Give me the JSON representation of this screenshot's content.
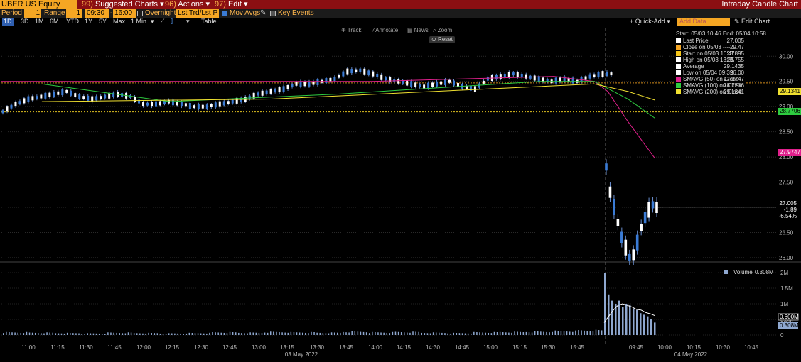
{
  "topbar": {
    "security": "UBER US Equity",
    "menus": [
      {
        "num": "99)",
        "label": "Suggested Charts",
        "arrow": "▾"
      },
      {
        "num": "96)",
        "label": "Actions",
        "arrow": "▾"
      },
      {
        "num": "97)",
        "label": "Edit",
        "arrow": "▾"
      }
    ],
    "title": "Intraday Candle Chart"
  },
  "settings": {
    "period_label": "Period",
    "period_value": "1",
    "range_label": "Range",
    "range_value": "1",
    "start_time": "09:30",
    "dash": "-",
    "end_time": "16:00",
    "overnight_label": "Overnight",
    "last_trd_value": "Lst Trd/Lst P",
    "mov_avgs_label": "Mov Avgs",
    "key_events_label": "Key Events"
  },
  "range_tabs": [
    "1D",
    "3D",
    "1M",
    "6M",
    "YTD",
    "1Y",
    "5Y",
    "Max"
  ],
  "interval": "1 Min",
  "interval_arrow": "▾",
  "table_label": "Table",
  "quick_add": "Quick-Add",
  "add_data_placeholder": "Add Data",
  "edit_chart": "Edit Chart",
  "chart_tools": {
    "track": "Track",
    "annotate": "Annotate",
    "news": "News",
    "zoom": "Zoom",
    "reset": "Reset"
  },
  "legend": {
    "header": "Start: 05/03 10:46 End: 05/04 10:58",
    "rows": [
      {
        "label": "Last Price",
        "value": "27.005",
        "color": "#ffffff"
      },
      {
        "label": "Close on 05/03 ----",
        "value": "29.47",
        "color": "#f5a623"
      },
      {
        "label": "Start on 05/03 10:47",
        "value": "28.895",
        "color": "#f5c518"
      },
      {
        "label": "High on 05/03 13:55",
        "value": "29.755",
        "color": "#ffffff"
      },
      {
        "label": "Average",
        "value": "29.1435",
        "color": "#ffffff"
      },
      {
        "label": "Low on 05/04 09:39",
        "value": "26.00",
        "color": "#ffffff"
      },
      {
        "label": "SMAVG (50)  on Close",
        "value": "27.9747",
        "color": "#e0208c"
      },
      {
        "label": "SMAVG (100)  on Close",
        "value": "28.7706",
        "color": "#2ecc40"
      },
      {
        "label": "SMAVG (200)  on Close",
        "value": "29.1341",
        "color": "#f0e030"
      }
    ]
  },
  "price_tags": [
    {
      "text": "29.1341",
      "bg": "#f0e030",
      "fg": "#000"
    },
    {
      "text": "28.7706",
      "bg": "#2ecc40",
      "fg": "#000"
    },
    {
      "text": "27.9747",
      "bg": "#e0208c",
      "fg": "#fff"
    }
  ],
  "last_tag": {
    "line1": "27.005",
    "line2": "-1.89",
    "line3": "-6.54%"
  },
  "volume_legend": {
    "label": "Volume",
    "value": "0.308M"
  },
  "volume_tags": {
    "avg": "0.600M",
    "last": "0.308M"
  },
  "chart_data": {
    "type": "candlestick",
    "y_ticks": [
      "30.00",
      "29.50",
      "29.00",
      "28.50",
      "28.00",
      "27.50",
      "27.00",
      "26.50",
      "26.00"
    ],
    "ylim": [
      25.9,
      30.3
    ],
    "volume_ticks": [
      "2M",
      "1.5M",
      "1M",
      "0.5M",
      "0"
    ],
    "x_ticks": [
      "11:00",
      "11:15",
      "11:30",
      "11:45",
      "12:00",
      "12:15",
      "12:30",
      "12:45",
      "13:00",
      "13:15",
      "13:30",
      "13:45",
      "14:00",
      "14:15",
      "14:30",
      "14:45",
      "15:00",
      "15:15",
      "15:30",
      "15:45",
      "09:45",
      "10:00",
      "10:15",
      "10:30",
      "10:45"
    ],
    "date_labels": [
      "03 May 2022",
      "04 May 2022"
    ],
    "close_line": 29.47,
    "start_line": 28.895,
    "day1_path": [
      28.9,
      29.05,
      29.15,
      29.2,
      29.25,
      29.3,
      29.2,
      29.15,
      29.2,
      29.25,
      29.2,
      29.05,
      29.05,
      29.1,
      29.05,
      29.0,
      29.0,
      29.05,
      29.1,
      29.15,
      29.25,
      29.3,
      29.35,
      29.45,
      29.45,
      29.5,
      29.55,
      29.7,
      29.72,
      29.65,
      29.55,
      29.5,
      29.45,
      29.4,
      29.45,
      29.5,
      29.4,
      29.35,
      29.55,
      29.6,
      29.65,
      29.6,
      29.55,
      29.5,
      29.55,
      29.5,
      29.6,
      29.65
    ],
    "day2_path": [
      27.8,
      27.3,
      27.0,
      26.7,
      26.4,
      26.2,
      26.0,
      26.05,
      26.3,
      26.6,
      26.8,
      26.95,
      27.05,
      27.0
    ],
    "sma50": [
      [
        0,
        29.5
      ],
      [
        0.55,
        29.5
      ],
      [
        0.82,
        29.6
      ],
      [
        0.88,
        29.5
      ],
      [
        0.9,
        29.3
      ],
      [
        0.93,
        28.7
      ],
      [
        0.97,
        27.97
      ]
    ],
    "sma100": [
      [
        0.06,
        29.45
      ],
      [
        0.25,
        29.1
      ],
      [
        0.5,
        29.25
      ],
      [
        0.8,
        29.5
      ],
      [
        0.88,
        29.5
      ],
      [
        0.93,
        29.15
      ],
      [
        0.97,
        28.77
      ]
    ],
    "sma200": [
      [
        0.06,
        29.1
      ],
      [
        0.4,
        29.15
      ],
      [
        0.8,
        29.4
      ],
      [
        0.88,
        29.45
      ],
      [
        0.93,
        29.3
      ],
      [
        0.97,
        29.13
      ]
    ],
    "volume_day1": [
      0.08,
      0.07,
      0.06,
      0.05,
      0.07,
      0.06,
      0.05,
      0.06,
      0.08,
      0.07,
      0.09,
      0.08,
      0.07,
      0.1,
      0.08,
      0.09,
      0.07,
      0.06,
      0.08,
      0.09,
      0.1,
      0.12,
      0.14
    ],
    "volume_day2": [
      2.0,
      1.3,
      1.1,
      1.0,
      1.1,
      0.9,
      1.0,
      0.95,
      0.85,
      0.8,
      0.7,
      0.65,
      0.6,
      0.5,
      0.4
    ],
    "volume_avg": [
      0.4,
      0.6,
      0.8,
      0.95,
      1.0,
      0.95,
      0.9,
      0.82,
      0.8,
      0.72,
      0.68,
      0.62
    ]
  }
}
